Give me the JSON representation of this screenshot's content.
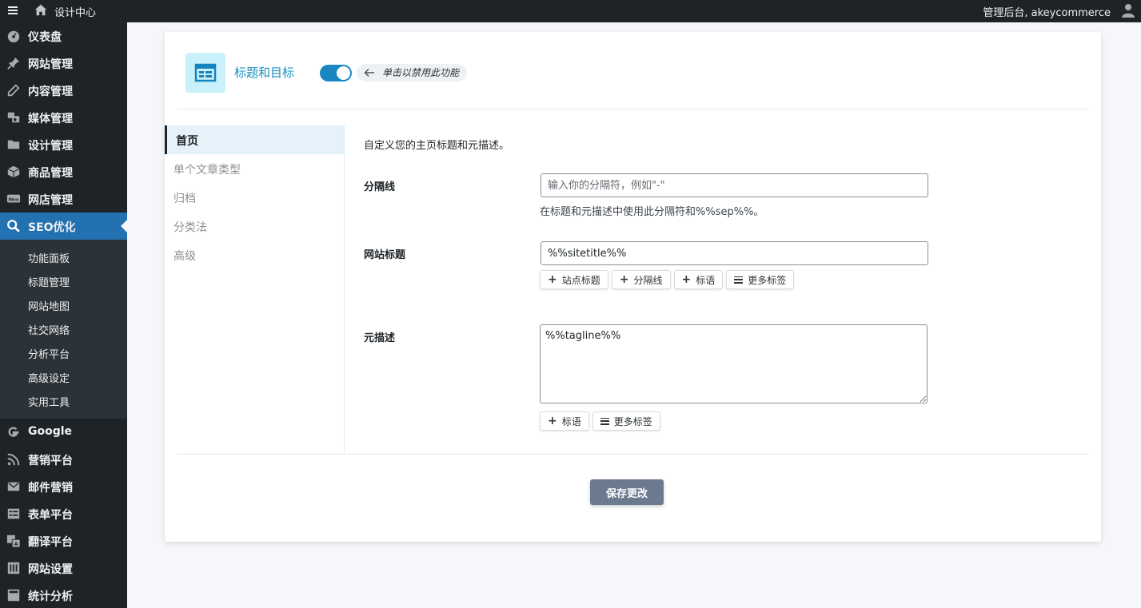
{
  "adminbar": {
    "site_name": "设计中心",
    "user_greeting": "管理后台, akeycommerce"
  },
  "sidebar": {
    "items": [
      {
        "label": "仪表盘",
        "icon": "dashboard-icon"
      },
      {
        "label": "网站管理",
        "icon": "pin-icon"
      },
      {
        "label": "内容管理",
        "icon": "pencil-icon"
      },
      {
        "label": "媒体管理",
        "icon": "media-icon"
      },
      {
        "label": "设计管理",
        "icon": "folder-icon"
      },
      {
        "label": "商品管理",
        "icon": "box-icon"
      },
      {
        "label": "网店管理",
        "icon": "woo-icon"
      },
      {
        "label": "SEO优化",
        "icon": "search-icon",
        "active": true
      }
    ],
    "submenu": [
      "功能面板",
      "标题管理",
      "网站地图",
      "社交网络",
      "分析平台",
      "高级设定",
      "实用工具"
    ],
    "items_after": [
      {
        "label": "Google",
        "icon": "google-icon"
      },
      {
        "label": "营销平台",
        "icon": "rss-icon"
      },
      {
        "label": "邮件营销",
        "icon": "mail-icon"
      },
      {
        "label": "表单平台",
        "icon": "form-icon"
      },
      {
        "label": "翻译平台",
        "icon": "translate-icon"
      },
      {
        "label": "网站设置",
        "icon": "settings-icon"
      },
      {
        "label": "统计分析",
        "icon": "stats-icon"
      }
    ]
  },
  "module": {
    "title": "标题和目标",
    "toggle_hint": "单击以禁用此功能",
    "enabled": true
  },
  "tabs": [
    "首页",
    "单个文章类型",
    "归档",
    "分类法",
    "高级"
  ],
  "form": {
    "intro": "自定义您的主页标题和元描述。",
    "separator": {
      "label": "分隔线",
      "placeholder": "输入你的分隔符，例如\"-\"",
      "value": "",
      "help": "在标题和元描述中使用此分隔符和%%sep%%。"
    },
    "site_title": {
      "label": "网站标题",
      "value": "%%sitetitle%%",
      "tags": [
        "站点标题",
        "分隔线",
        "标语"
      ],
      "more_tags": "更多标签"
    },
    "meta_description": {
      "label": "元描述",
      "value": "%%tagline%%",
      "tags": [
        "标语"
      ],
      "more_tags": "更多标签"
    },
    "save_label": "保存更改"
  },
  "colors": {
    "admin_dark": "#1d2327",
    "accent_blue": "#2271b1",
    "title_blue": "#1b8fc1",
    "save_button": "#6b7a8f"
  }
}
